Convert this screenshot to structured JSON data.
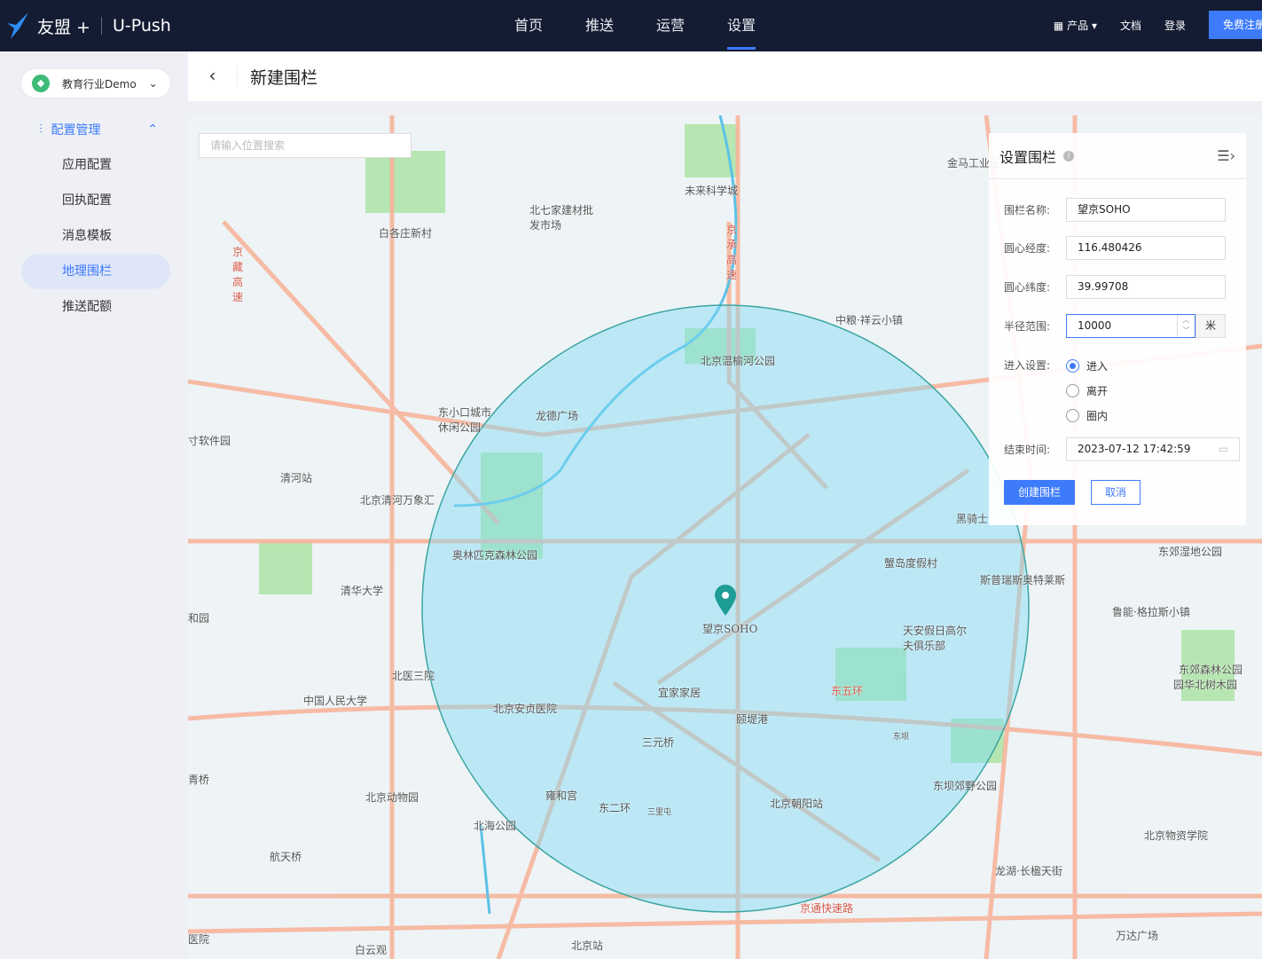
{
  "topbar": {
    "brand": "友盟 +",
    "product": "U-Push",
    "nav": [
      "首页",
      "推送",
      "运营",
      "设置"
    ],
    "active_nav": "设置",
    "products": "产品",
    "docs": "文档",
    "login": "登录",
    "register": "免费注册"
  },
  "sidebar": {
    "app": "教育行业Demo",
    "group": "配置管理",
    "items": [
      "应用配置",
      "回执配置",
      "消息模板",
      "地理围栏",
      "推送配额"
    ],
    "active": "地理围栏"
  },
  "header": {
    "title": "新建围栏"
  },
  "map": {
    "search_placeholder": "请输入位置搜索",
    "marker_label": "望京SOHO",
    "circle_color": "#7fdcf5",
    "labels": [
      "金马工业区",
      "未来科学城",
      "北七家建材批发市场",
      "白各庄新村",
      "京藏高速",
      "京承高速",
      "中粮·祥云小镇",
      "北京温榆河公园",
      "东小口城市休闲公园",
      "龙德广场",
      "寸软件园",
      "清河站",
      "北京清河万象汇",
      "奥林匹克森林公园",
      "清华大学",
      "蟹岛度假村",
      "斯普瑞斯奥特莱斯",
      "东郊湿地公园",
      "鲁能·格拉斯小镇",
      "天安假日高尔夫俱乐部",
      "北医三院",
      "中国人民大学",
      "北京安贞医院",
      "宜家家居",
      "颐堤港",
      "三元桥",
      "东五环",
      "东坝",
      "东郊森林公园",
      "园华北树木园",
      "东坝郊野公园",
      "北京朝阳站",
      "雍和宫",
      "北京动物园",
      "北海公园",
      "三里屯",
      "东二环",
      "航天桥",
      "北京物资学院",
      "龙湖·长楹天街",
      "京通快速路",
      "万达广场",
      "北京站",
      "白云观",
      "黑骑士",
      "和园",
      "青桥",
      "医院"
    ]
  },
  "panel": {
    "title": "设置围栏",
    "name_label": "围栏名称:",
    "name": "望京SOHO",
    "lng_label": "圆心经度:",
    "lng": "116.480426",
    "lat_label": "圆心纬度:",
    "lat": "39.99708",
    "radius_label": "半径范围:",
    "radius": "10000",
    "radius_unit": "米",
    "enter_label": "进入设置:",
    "options": [
      "进入",
      "离开",
      "圈内"
    ],
    "selected": "进入",
    "end_label": "结束时间:",
    "end_time": "2023-07-12 17:42:59",
    "create": "创建围栏",
    "cancel": "取消"
  },
  "colors": {
    "accent": "#3e7bfa",
    "topbar": "#141c33"
  }
}
